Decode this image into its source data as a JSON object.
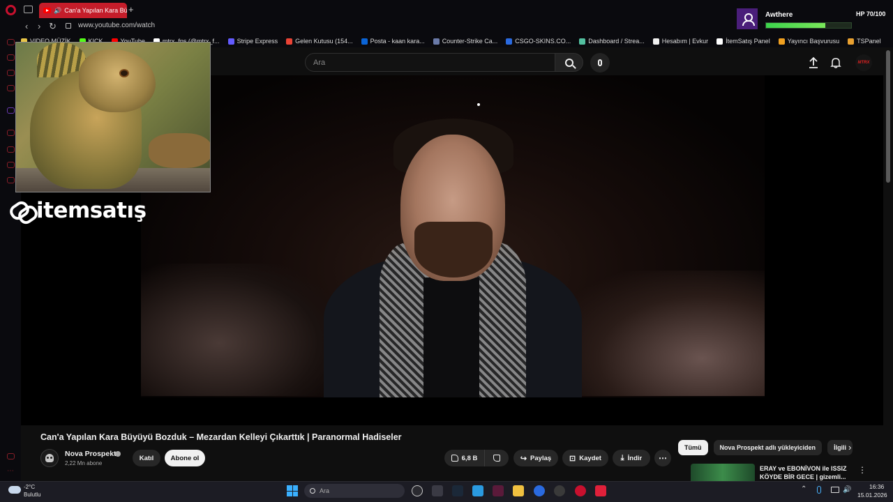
{
  "browser": {
    "tab_title": "Can'a Yapılan Kara Bü",
    "url": "www.youtube.com/watch",
    "bookmarks": [
      {
        "label": "VIDEO MÜZİK",
        "color": "#e8c547"
      },
      {
        "label": "KICK",
        "color": "#53fc18"
      },
      {
        "label": "YouTube",
        "color": "#ff0000"
      },
      {
        "label": "mtrx_fps (@mtrx_f...",
        "color": "#ffffff"
      },
      {
        "label": "Stripe Express",
        "color": "#635bff"
      },
      {
        "label": "Gelen Kutusu (154...",
        "color": "#ea4335"
      },
      {
        "label": "Posta - kaan kara...",
        "color": "#0a64d6"
      },
      {
        "label": "Counter-Strike Ca...",
        "color": "#6a7aa8"
      },
      {
        "label": "CSGO-SKINS.CO...",
        "color": "#2a6ae0"
      },
      {
        "label": "Dashboard / Strea...",
        "color": "#53c0a0"
      },
      {
        "label": "Hesabım | Evkur",
        "color": "#f0f0f0"
      },
      {
        "label": "İtemSatış Panel",
        "color": "#ffffff"
      },
      {
        "label": "Yayıncı Başvurusu",
        "color": "#f0a020"
      },
      {
        "label": "TSPanel",
        "color": "#e8a030"
      }
    ]
  },
  "youtube": {
    "search_placeholder": "Ara",
    "avatar_text": "MTRX",
    "video_title": "Can'a Yapılan Kara Büyüyü Bozduk – Mezardan Kelleyi Çıkarttık | Paranormal Hadiseler",
    "channel_name": "Nova Prospekt",
    "subscribers": "2,22 Mn abone",
    "join_label": "Katıl",
    "subscribe_label": "Abone ol",
    "like_count": "6,8 B",
    "share_label": "Paylaş",
    "save_label": "Kaydet",
    "download_label": "İndir",
    "more_label": "⋯",
    "chips": [
      "Tümü",
      "Nova Prospekt adlı yükleyiciden",
      "İlgili"
    ],
    "rec_title": "ERAY ve EBONİVON ile ISSIZ KÖYDE BİR GECE | gizemli..."
  },
  "overlay": {
    "brand_text": "itemsatış",
    "hp_name": "Awthere",
    "hp_label": "HP 70/100",
    "hp_value": 70,
    "hp_max": 100
  },
  "taskbar": {
    "temp": "-2°C",
    "weather": "Bulutlu",
    "search_placeholder": "Ara",
    "time": "16:36",
    "date": "15.01.2026"
  }
}
